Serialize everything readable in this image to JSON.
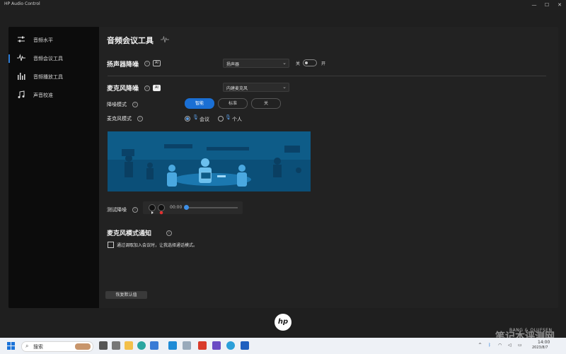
{
  "window": {
    "title": "HP Audio Control",
    "minimize": "—",
    "maximize": "☐",
    "close": "✕"
  },
  "sidebar": {
    "items": [
      {
        "label": "音频水平",
        "icon": "sliders-icon"
      },
      {
        "label": "音频会议工具",
        "icon": "waveform-icon"
      },
      {
        "label": "音频播放工具",
        "icon": "equalizer-icon"
      },
      {
        "label": "声音校准",
        "icon": "music-note-icon"
      }
    ],
    "active_index": 1
  },
  "main": {
    "title": "音频会议工具",
    "speaker": {
      "label": "扬声器降噪",
      "ai_badge": "AI",
      "device": "扬声器",
      "toggle_off_label": "关",
      "toggle_on_label": "开"
    },
    "mic": {
      "label": "麦克风降噪",
      "ai_badge": "AI",
      "device": "内建麦克风",
      "noise_mode_label": "降噪模式",
      "noise_modes": [
        "智能",
        "标准",
        "关"
      ],
      "noise_mode_selected": 0,
      "mic_mode_label": "麦克风模式",
      "mic_modes": [
        "会议",
        "个人"
      ],
      "mic_mode_selected": 0
    },
    "test": {
      "label": "测试降噪",
      "time": "00:00"
    },
    "notify": {
      "label": "麦克风模式通知",
      "checkbox_text": "通过调取加入会议时，让我选择通话模式。",
      "checked": false
    },
    "reset_button": "恢复默认值"
  },
  "branding": {
    "hp": "hp",
    "bo": "BANG & OLUFSEN",
    "watermark": "笔记本评测网"
  },
  "taskbar": {
    "search_placeholder": "搜索",
    "clock_time": "14:00",
    "clock_date": "2023/8/7"
  },
  "colors": {
    "accent": "#1a6fd4",
    "illustration": "#0e5c88",
    "record": "#e03030"
  }
}
